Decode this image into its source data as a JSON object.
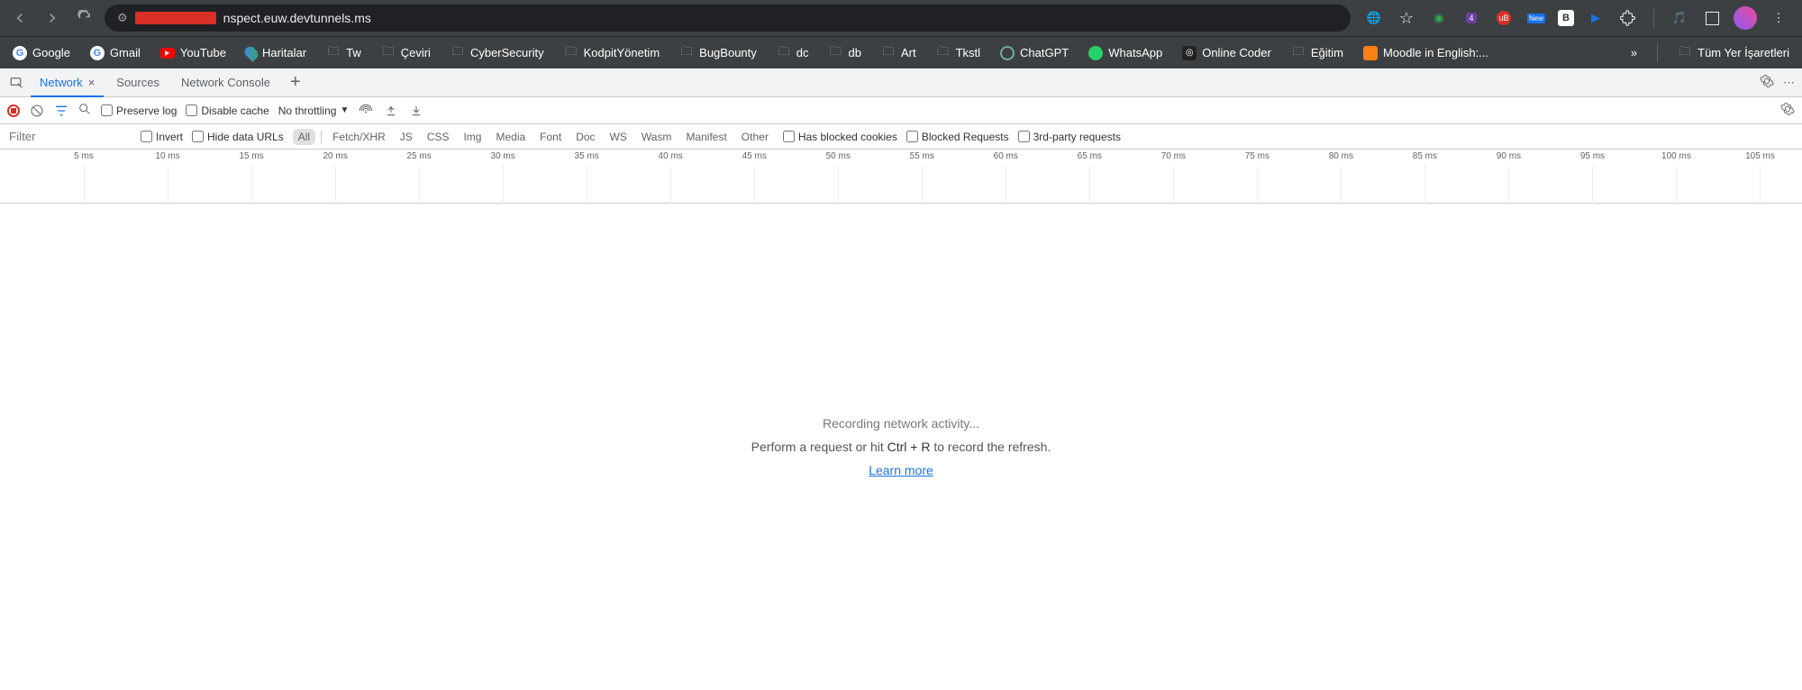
{
  "browser": {
    "url_suffix": "nspect.euw.devtunnels.ms",
    "extensions": {
      "translate": "Translate",
      "badge4": "4",
      "ub": "uB",
      "new": "New",
      "b": "B"
    }
  },
  "bookmarks": {
    "items": [
      "Google",
      "Gmail",
      "YouTube",
      "Haritalar",
      "Tw",
      "Çeviri",
      "CyberSecurity",
      "KodpitYönetim",
      "BugBounty",
      "dc",
      "db",
      "Art",
      "Tkstl",
      "ChatGPT",
      "WhatsApp",
      "Online Coder",
      "Eğitim",
      "Moodle in English:..."
    ],
    "overflow": "»",
    "all": "Tüm Yer İşaretleri"
  },
  "devtools": {
    "tabs": {
      "network": "Network",
      "sources": "Sources",
      "console": "Network Console"
    }
  },
  "toolbar": {
    "preserve": "Preserve log",
    "disable_cache": "Disable cache",
    "throttling": "No throttling"
  },
  "filter": {
    "placeholder": "Filter",
    "invert": "Invert",
    "hide_urls": "Hide data URLs",
    "types": [
      "All",
      "Fetch/XHR",
      "JS",
      "CSS",
      "Img",
      "Media",
      "Font",
      "Doc",
      "WS",
      "Wasm",
      "Manifest",
      "Other"
    ],
    "blocked_cookies": "Has blocked cookies",
    "blocked_req": "Blocked Requests",
    "third_party": "3rd-party requests"
  },
  "timeline": {
    "ticks": [
      "5 ms",
      "10 ms",
      "15 ms",
      "20 ms",
      "25 ms",
      "30 ms",
      "35 ms",
      "40 ms",
      "45 ms",
      "50 ms",
      "55 ms",
      "60 ms",
      "65 ms",
      "70 ms",
      "75 ms",
      "80 ms",
      "85 ms",
      "90 ms",
      "95 ms",
      "100 ms",
      "105 ms"
    ]
  },
  "empty": {
    "line1": "Recording network activity...",
    "line2_a": "Perform a request or hit ",
    "line2_kbd": "Ctrl + R",
    "line2_b": " to record the refresh.",
    "learn": "Learn more"
  }
}
